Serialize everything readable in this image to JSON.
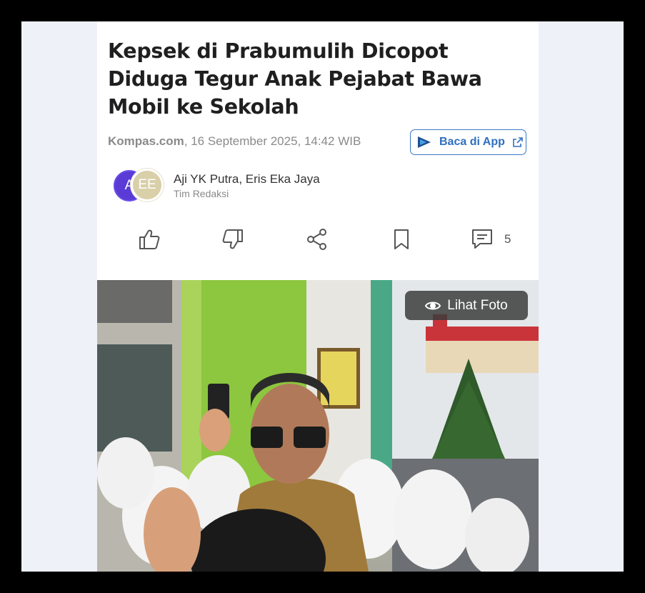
{
  "article": {
    "headline": "Kepsek di Prabumulih Dicopot Diduga Tegur Anak Pejabat Bawa Mobil ke Sekolah",
    "source": "Kompas.com",
    "date": ", 16 September 2025, 14:42 WIB",
    "app_button_label": "Baca di App",
    "avatar_1_initial": "A",
    "avatar_2_initials": "EE",
    "authors": "Aji YK Putra,  Eris Eka Jaya",
    "team": "Tim Redaksi",
    "comment_count": "5",
    "photo_button_label": "Lihat Foto"
  },
  "icons": {
    "like": "thumbs-up-icon",
    "dislike": "thumbs-down-icon",
    "share": "share-icon",
    "bookmark": "bookmark-icon",
    "comment": "comment-icon",
    "eye": "eye-icon",
    "external": "external-link-icon"
  },
  "colors": {
    "accent": "#2f6fbf",
    "avatar_1": "#5a3bd6",
    "avatar_2": "#d9cfa8"
  }
}
